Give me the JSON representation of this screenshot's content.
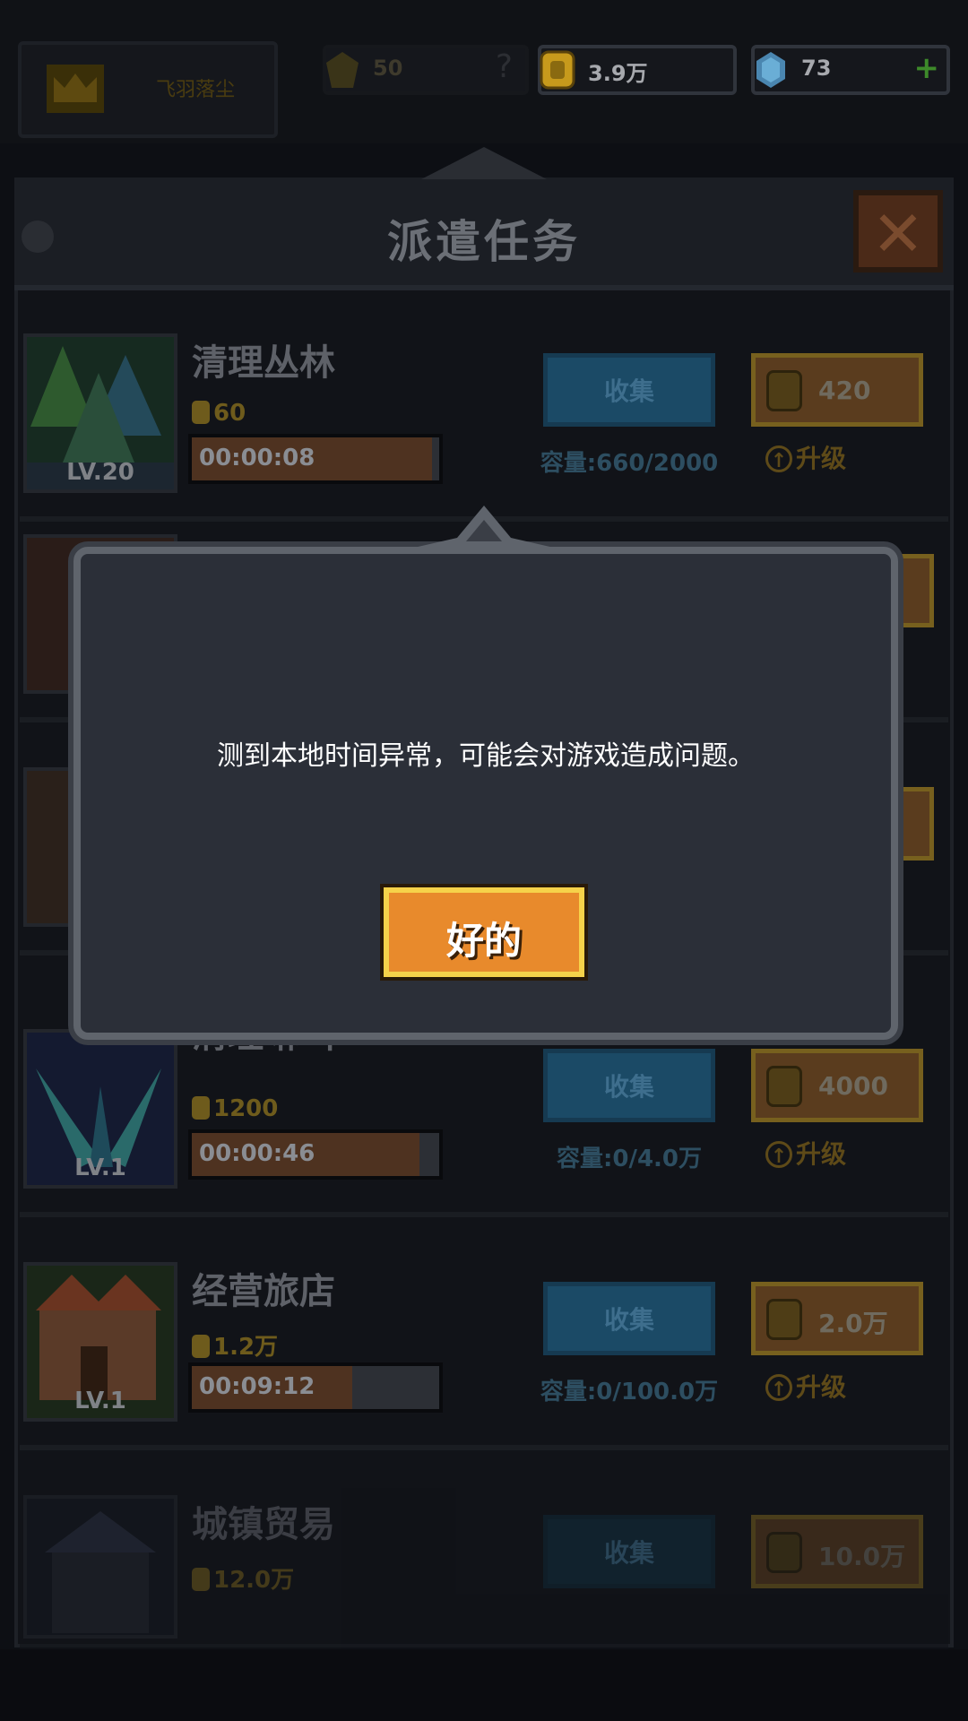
{
  "top_bar": {
    "player_name": "飞羽落尘",
    "power": "50",
    "help_symbol": "?",
    "gold": "3.9万",
    "gems": "73",
    "add_symbol": "+"
  },
  "panel": {
    "title": "派遣任务",
    "close_symbol": "✕"
  },
  "labels": {
    "collect": "收集",
    "upgrade": "升级",
    "upgrade_arrow": "↑"
  },
  "tasks": [
    {
      "name": "清理丛林",
      "level": "LV.20",
      "reward": "60",
      "timer": "00:00:08",
      "progress": 0.97,
      "cost": "420",
      "capacity": "容量:660/2000"
    },
    {
      "name": "清理洞穴",
      "level": "LV.1",
      "reward": "1200",
      "timer": "00:00:46",
      "progress": 0.92,
      "cost": "4000",
      "capacity": "容量:0/4.0万"
    },
    {
      "name": "经营旅店",
      "level": "LV.1",
      "reward": "1.2万",
      "timer": "00:09:12",
      "progress": 0.65,
      "cost": "2.0万",
      "capacity": "容量:0/100.0万"
    },
    {
      "name": "城镇贸易",
      "level": "",
      "reward": "12.0万",
      "timer": "",
      "progress": 0,
      "cost": "10.0万",
      "capacity": ""
    }
  ],
  "partial_row_name": "清理琳叫",
  "dialog": {
    "message": "测到本地时间异常，可能会对游戏造成问题。",
    "ok_label": "好的"
  },
  "colors": {
    "dialog_bg": "#2b2f38",
    "ok_button": "#e88a2c",
    "ok_border": "#f6d24a"
  }
}
